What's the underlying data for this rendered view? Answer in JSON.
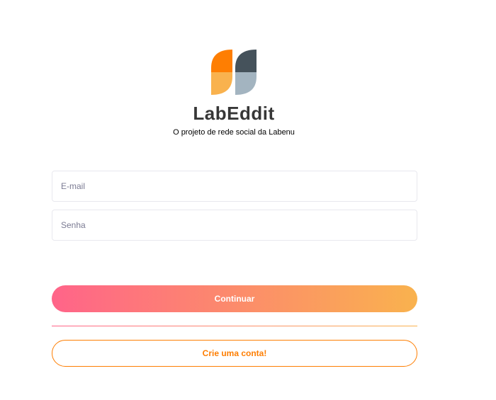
{
  "brand": {
    "name": "LabEddit",
    "tagline": "O projeto de rede social da Labenu",
    "logo_icon": "labenu-logo-icon",
    "colors": {
      "orange": "#FE7E02",
      "light_orange": "#F9B24E",
      "dark_gray": "#45525B",
      "light_gray": "#A3B4C0"
    }
  },
  "form": {
    "email_placeholder": "E-mail",
    "email_value": "",
    "password_placeholder": "Senha",
    "password_value": ""
  },
  "actions": {
    "continue_label": "Continuar",
    "signup_label": "Crie uma conta!"
  },
  "theme": {
    "gradient_start": "#FF6489",
    "gradient_end": "#F9B24E",
    "accent": "#FE7E02"
  }
}
